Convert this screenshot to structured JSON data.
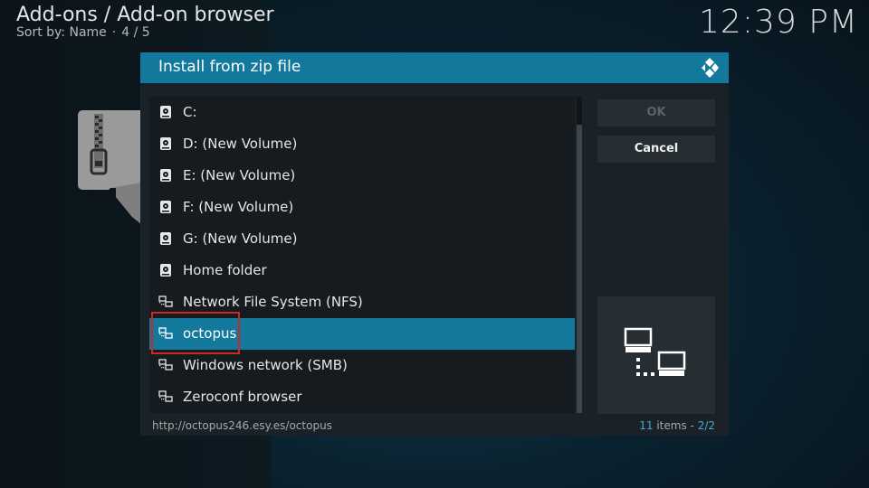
{
  "header": {
    "title": "Add-ons / Add-on browser",
    "sort_label": "Sort by: Name",
    "separator": "·",
    "position": "4 / 5",
    "clock": "12:39 PM"
  },
  "dialog": {
    "title": "Install from zip file",
    "ok_label": "OK",
    "cancel_label": "Cancel",
    "items": [
      {
        "label": "C:",
        "icon": "hard-drive-icon"
      },
      {
        "label": "D: (New Volume)",
        "icon": "hard-drive-icon"
      },
      {
        "label": "E: (New Volume)",
        "icon": "hard-drive-icon"
      },
      {
        "label": "F: (New Volume)",
        "icon": "hard-drive-icon"
      },
      {
        "label": "G: (New Volume)",
        "icon": "hard-drive-icon"
      },
      {
        "label": "Home folder",
        "icon": "hard-drive-icon"
      },
      {
        "label": "Network File System (NFS)",
        "icon": "network-icon"
      },
      {
        "label": "octopus",
        "icon": "network-icon",
        "selected": true
      },
      {
        "label": "Windows network (SMB)",
        "icon": "network-icon"
      },
      {
        "label": "Zeroconf browser",
        "icon": "network-icon"
      }
    ],
    "footer": {
      "path": "http://octopus246.esy.es/octopus",
      "count": "11",
      "count_suffix": "items -",
      "page": "2/2"
    }
  },
  "colors": {
    "accent": "#12799c",
    "highlight_box": "#d02626",
    "dialog_bg": "#1b2227"
  }
}
